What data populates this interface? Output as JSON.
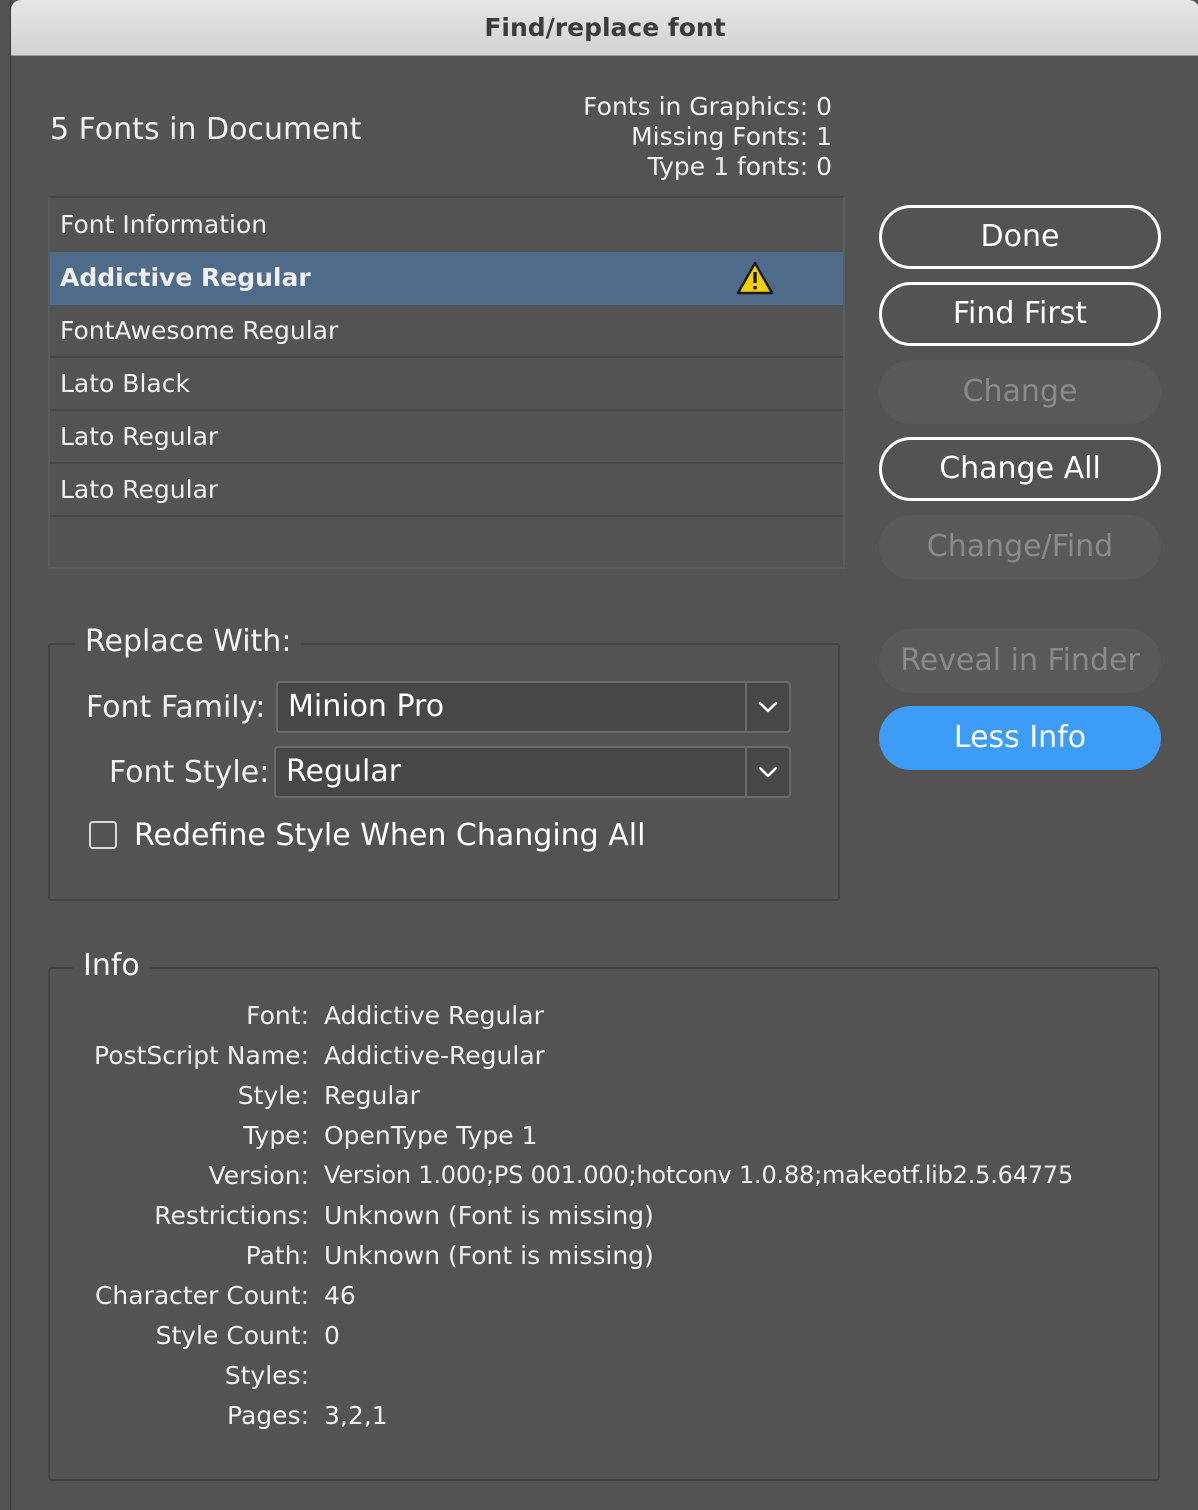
{
  "window": {
    "title": "Find/replace font"
  },
  "summary": {
    "fonts_in_document": "5 Fonts in Document",
    "fonts_in_graphics": "Fonts in Graphics: 0",
    "missing_fonts": "Missing Fonts: 1",
    "type1_fonts": "Type 1 fonts: 0"
  },
  "font_list": {
    "header": "Font Information",
    "rows": [
      {
        "name": "Addictive Regular",
        "selected": true,
        "warning": true
      },
      {
        "name": "FontAwesome Regular"
      },
      {
        "name": "Lato Black"
      },
      {
        "name": "Lato Regular"
      },
      {
        "name": "Lato Regular"
      }
    ]
  },
  "buttons": {
    "done": "Done",
    "find_first": "Find First",
    "change": "Change",
    "change_all": "Change All",
    "change_find": "Change/Find",
    "reveal": "Reveal in Finder",
    "less_info": "Less Info"
  },
  "replace": {
    "legend": "Replace With:",
    "font_family_label": "Font Family:",
    "font_family_value": "Minion Pro",
    "font_style_label": "Font Style:",
    "font_style_value": "Regular",
    "redefine_label": "Redefine Style When Changing All",
    "redefine_checked": false
  },
  "info": {
    "legend": "Info",
    "rows": [
      {
        "key": "Font:",
        "value": "Addictive Regular"
      },
      {
        "key": "PostScript Name:",
        "value": "Addictive-Regular"
      },
      {
        "key": "Style:",
        "value": "Regular"
      },
      {
        "key": "Type:",
        "value": "OpenType Type 1"
      },
      {
        "key": "Version:",
        "value": "Version 1.000;PS 001.000;hotconv 1.0.88;makeotf.lib2.5.64775"
      },
      {
        "key": "Restrictions:",
        "value": "Unknown (Font is missing)"
      },
      {
        "key": "Path:",
        "value": "Unknown (Font is missing)"
      },
      {
        "key": "Character Count:",
        "value": "46"
      },
      {
        "key": "Style Count:",
        "value": "0"
      },
      {
        "key": "Styles:",
        "value": ""
      },
      {
        "key": "Pages:",
        "value": "3,2,1"
      }
    ]
  },
  "colors": {
    "background": "#535353",
    "selection": "#4f6b8a",
    "primary_button": "#3d9cf5",
    "warning": "#f5d000"
  },
  "icons": {
    "warning": "warning-triangle-icon",
    "dropdown": "chevron-down-icon"
  }
}
